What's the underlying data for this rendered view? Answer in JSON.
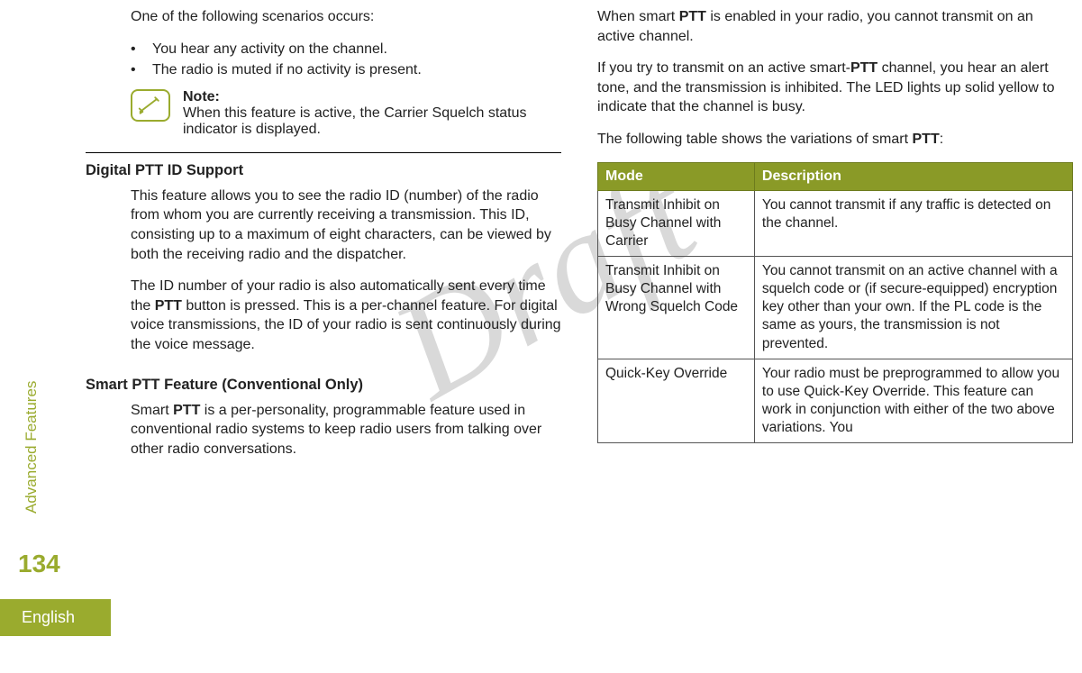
{
  "sidebar": {
    "section_label": "Advanced Features",
    "page_number": "134",
    "language": "English"
  },
  "watermark": "Draft",
  "left": {
    "scenario_intro": "One of the following scenarios occurs:",
    "bullets": [
      "You hear any activity on the channel.",
      "The radio is muted if no activity is present."
    ],
    "note_label": "Note:",
    "note_body": "When this feature is active, the Carrier Squelch status indicator is displayed.",
    "digital_head": "Digital PTT ID Support",
    "digital_p1": "This feature allows you to see the radio ID (number) of the radio from whom you are currently receiving a transmission. This ID, consisting up to a maximum of eight characters, can be viewed by both the receiving radio and the dispatcher.",
    "digital_p2_a": "The ID number of your radio is also automatically sent every time the ",
    "digital_p2_bold": "PTT",
    "digital_p2_b": " button is pressed. This is a per-channel feature. For digital voice transmissions, the ID of your radio is sent continuously during the voice message.",
    "smart_head": "Smart PTT Feature (Conventional Only)",
    "smart_p1_a": "Smart ",
    "smart_p1_bold": "PTT",
    "smart_p1_b": " is a per-personality, programmable feature used in conventional radio systems to keep radio users from talking over other radio conversations."
  },
  "right": {
    "p1_a": "When smart ",
    "p1_bold": "PTT",
    "p1_b": " is enabled in your radio, you cannot transmit on an active channel.",
    "p2_a": "If you try to transmit on an active smart-",
    "p2_bold": "PTT",
    "p2_b": " channel, you hear an alert tone, and the transmission is inhibited. The LED lights up solid yellow to indicate that the channel is busy.",
    "p3_a": "The following table shows the variations of smart ",
    "p3_bold": "PTT",
    "p3_b": ":",
    "table": {
      "h1": "Mode",
      "h2": "Description",
      "rows": [
        {
          "mode": "Transmit Inhibit on Busy Channel with Carrier",
          "desc": "You cannot transmit if any traffic is detected on the channel."
        },
        {
          "mode": "Transmit Inhibit on Busy Channel with Wrong Squelch Code",
          "desc": "You cannot transmit on an active channel with a squelch code or (if secure-equipped) encryption key other than your own. If the PL code is the same as yours, the transmission is not prevented."
        },
        {
          "mode": "Quick-Key Override",
          "desc": "Your radio must be preprogrammed to allow you to use Quick-Key Override. This feature can work in conjunction with either of the two above variations. You"
        }
      ]
    }
  }
}
